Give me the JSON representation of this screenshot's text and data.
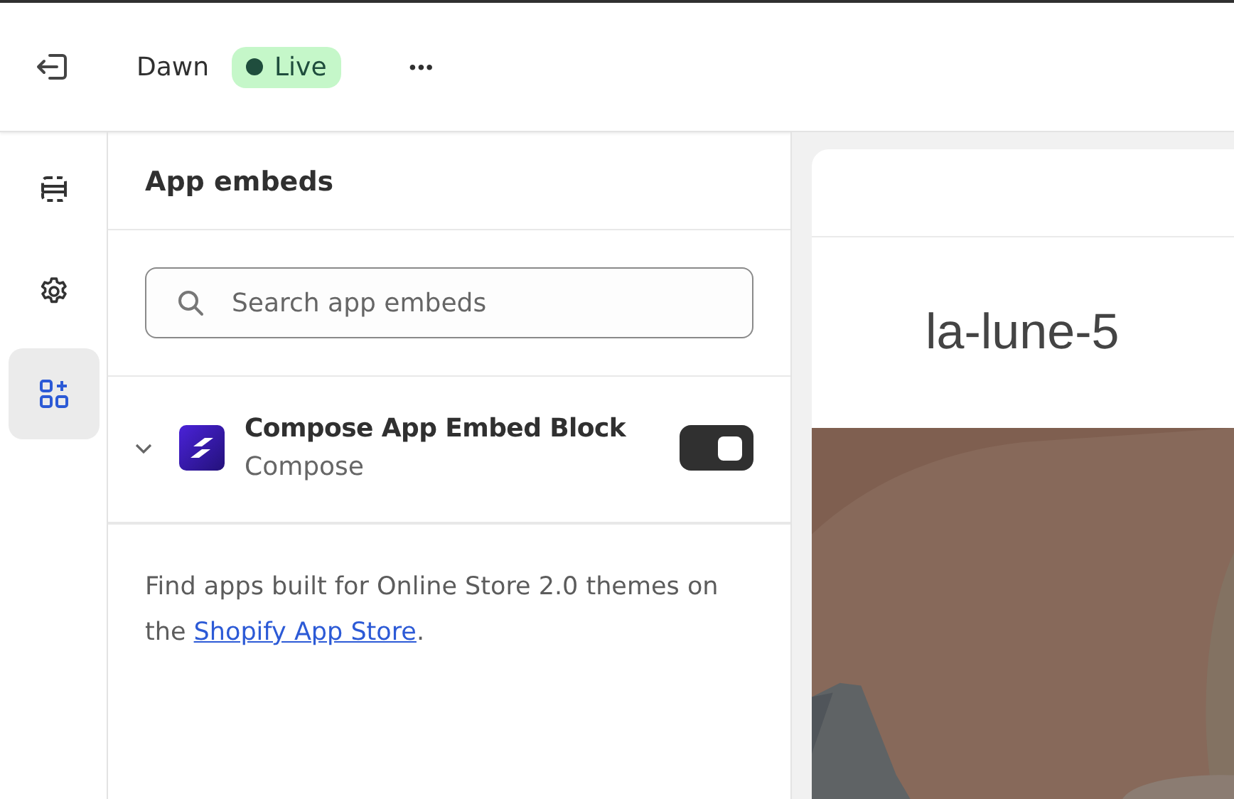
{
  "topbar": {
    "theme_name": "Dawn",
    "status": {
      "label": "Live",
      "color": "#1f4d3d"
    },
    "more": "•••"
  },
  "rail": [
    {
      "kind": "sections",
      "selected": false
    },
    {
      "kind": "settings",
      "selected": false
    },
    {
      "kind": "apps",
      "selected": true
    }
  ],
  "panel": {
    "title": "App embeds",
    "search": {
      "placeholder": "Search app embeds"
    },
    "embeds": [
      {
        "name": "Compose App Embed Block",
        "app": "Compose",
        "expanded": false,
        "on": true
      }
    ],
    "footer": {
      "text": "Find apps built for Online Store 2.0 themes on the ",
      "link": "Shopify App Store",
      "end": "."
    }
  },
  "preview": {
    "store_name": "la-lune-5"
  }
}
